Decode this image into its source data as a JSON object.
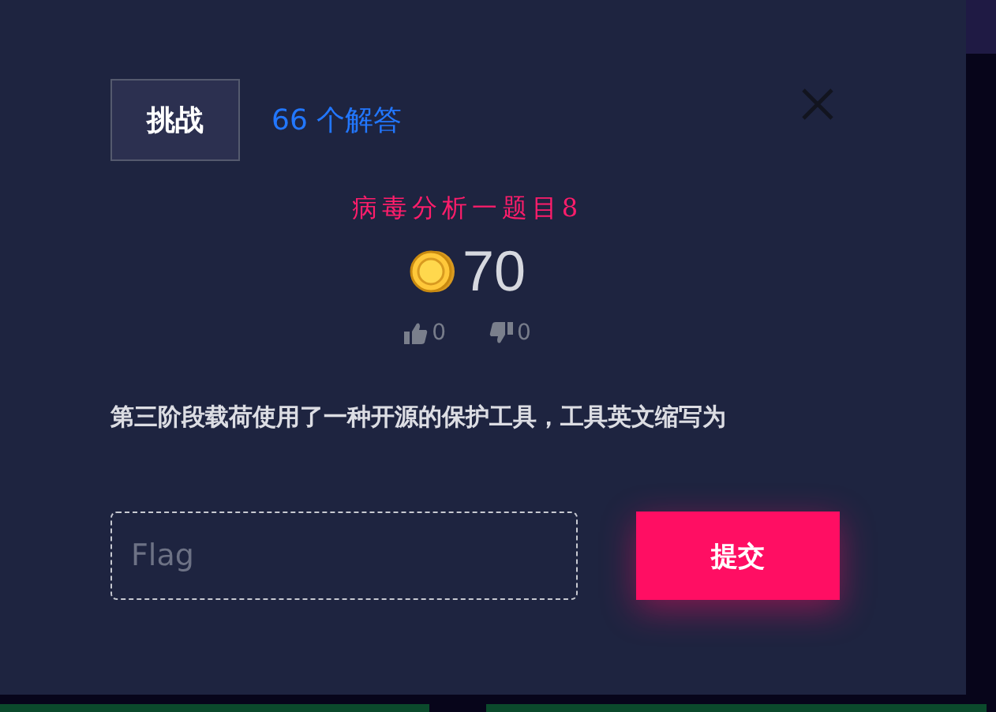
{
  "tabs": [
    {
      "label": "挑战",
      "selected": true
    }
  ],
  "solves_link": "66 个解答",
  "title": "病毒分析一题目8",
  "points": "70",
  "likes": "0",
  "dislikes": "0",
  "description": "第三阶段载荷使用了一种开源的保护工具，工具英文缩写为",
  "flag_field": {
    "placeholder": "Flag"
  },
  "submit_button": "提交"
}
